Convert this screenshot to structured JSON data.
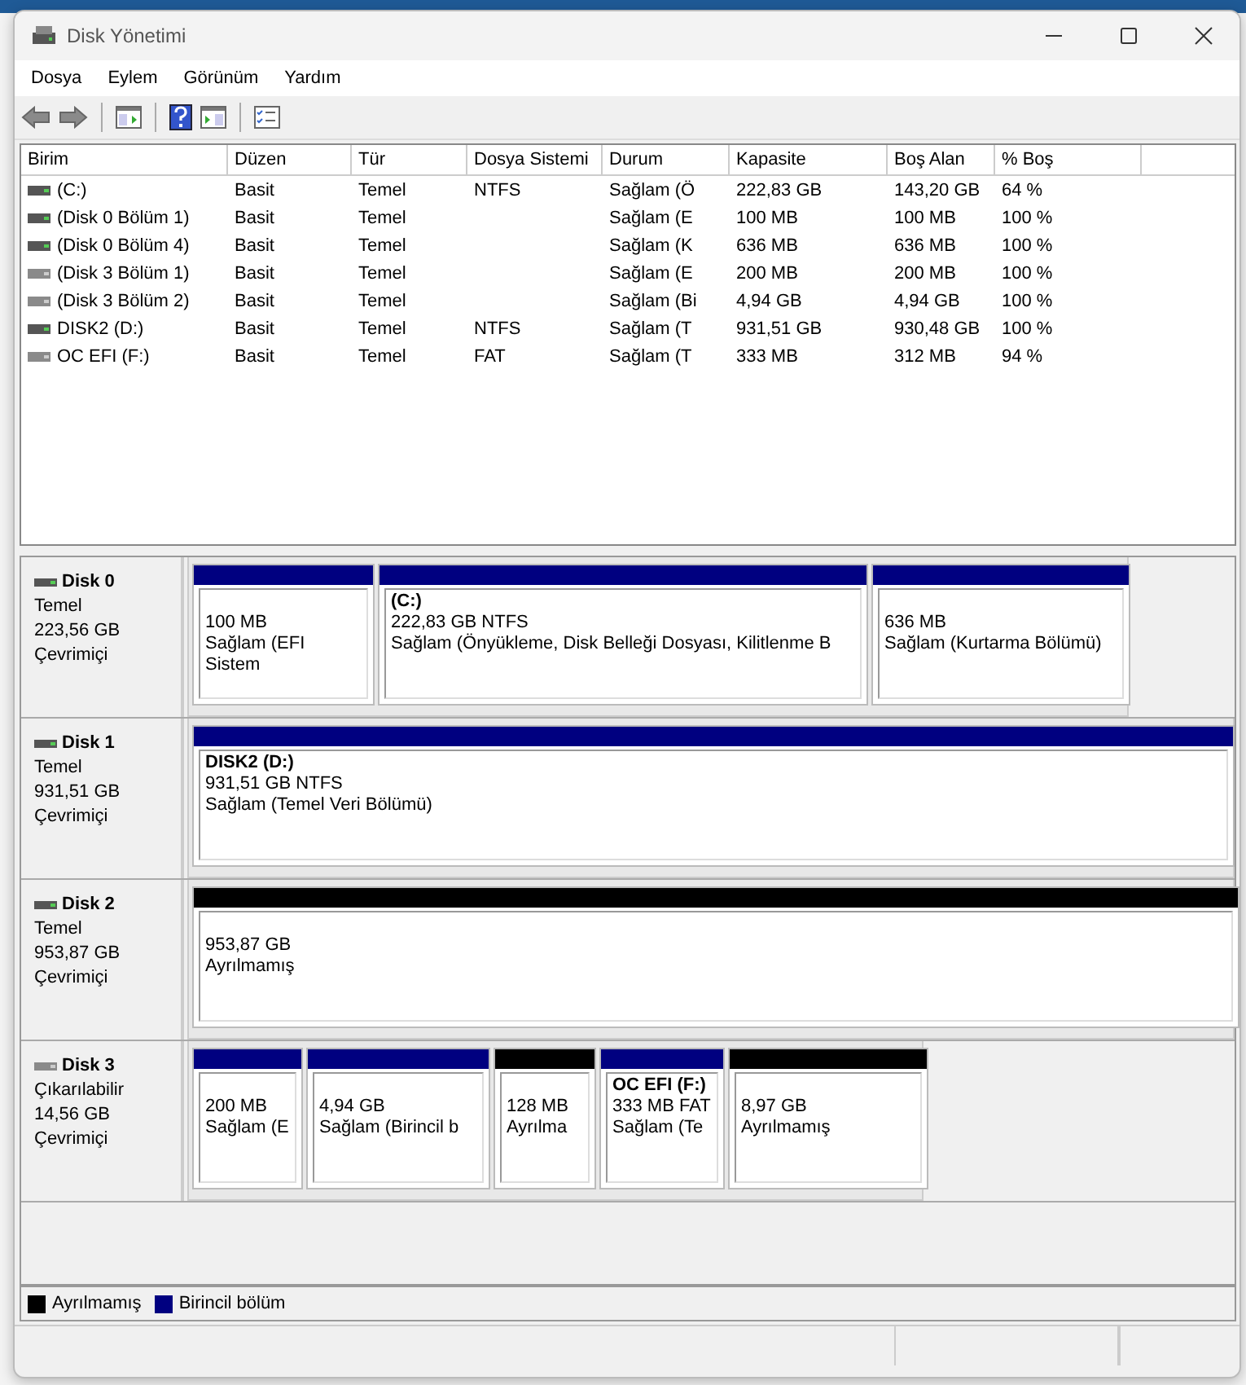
{
  "window": {
    "title": "Disk Yönetimi"
  },
  "menu": [
    "Dosya",
    "Eylem",
    "Görünüm",
    "Yardım"
  ],
  "volume_table": {
    "columns": [
      "Birim",
      "Düzen",
      "Tür",
      "Dosya Sistemi",
      "Durum",
      "Kapasite",
      "Boş Alan",
      "% Boş"
    ],
    "rows": [
      {
        "removable": false,
        "cells": [
          " (C:)",
          "Basit",
          "Temel",
          "NTFS",
          "Sağlam (Ö",
          "222,83 GB",
          "143,20 GB",
          "64 %"
        ]
      },
      {
        "removable": false,
        "cells": [
          "(Disk 0 Bölüm 1)",
          "Basit",
          "Temel",
          "",
          "Sağlam (E",
          "100 MB",
          "100 MB",
          "100 %"
        ]
      },
      {
        "removable": false,
        "cells": [
          "(Disk 0 Bölüm 4)",
          "Basit",
          "Temel",
          "",
          "Sağlam (K",
          "636 MB",
          "636 MB",
          "100 %"
        ]
      },
      {
        "removable": true,
        "cells": [
          "(Disk 3 Bölüm 1)",
          "Basit",
          "Temel",
          "",
          "Sağlam (E",
          "200 MB",
          "200 MB",
          "100 %"
        ]
      },
      {
        "removable": true,
        "cells": [
          "(Disk 3 Bölüm 2)",
          "Basit",
          "Temel",
          "",
          "Sağlam (Bi",
          "4,94 GB",
          "4,94 GB",
          "100 %"
        ]
      },
      {
        "removable": false,
        "cells": [
          "DISK2 (D:)",
          "Basit",
          "Temel",
          "NTFS",
          "Sağlam (T",
          "931,51 GB",
          "930,48 GB",
          "100 %"
        ]
      },
      {
        "removable": true,
        "cells": [
          "OC EFI (F:)",
          "Basit",
          "Temel",
          "FAT",
          "Sağlam (T",
          "333 MB",
          "312 MB",
          "94 %"
        ]
      }
    ]
  },
  "disks": [
    {
      "name": "Disk 0",
      "type": "Temel",
      "size": "223,56 GB",
      "status": "Çevrimiçi",
      "removable": false,
      "partitions": [
        {
          "kind": "primary",
          "lines": [
            "100 MB",
            "Sağlam (EFI Sistem"
          ]
        },
        {
          "kind": "primary",
          "label": " (C:)",
          "lines": [
            "222,83 GB NTFS",
            "Sağlam (Önyükleme, Disk Belleği Dosyası, Kilitlenme B"
          ]
        },
        {
          "kind": "primary",
          "lines": [
            "636 MB",
            "Sağlam (Kurtarma Bölümü)"
          ]
        }
      ]
    },
    {
      "name": "Disk 1",
      "type": "Temel",
      "size": "931,51 GB",
      "status": "Çevrimiçi",
      "removable": false,
      "partitions": [
        {
          "kind": "primary",
          "label": "DISK2  (D:)",
          "lines": [
            "931,51 GB NTFS",
            "Sağlam (Temel Veri Bölümü)"
          ]
        }
      ]
    },
    {
      "name": "Disk 2",
      "type": "Temel",
      "size": "953,87 GB",
      "status": "Çevrimiçi",
      "removable": false,
      "partitions": [
        {
          "kind": "unallocated",
          "lines": [
            "953,87 GB",
            "Ayrılmamış"
          ]
        }
      ]
    },
    {
      "name": "Disk 3",
      "type": "Çıkarılabilir",
      "size": "14,56 GB",
      "status": "Çevrimiçi",
      "removable": true,
      "partitions": [
        {
          "kind": "primary",
          "lines": [
            "200 MB",
            "Sağlam (E"
          ]
        },
        {
          "kind": "primary",
          "lines": [
            "4,94 GB",
            "Sağlam (Birincil b"
          ]
        },
        {
          "kind": "unallocated",
          "lines": [
            "128 MB",
            "Ayrılma"
          ]
        },
        {
          "kind": "primary",
          "label": "OC EFI  (F:)",
          "lines": [
            "333 MB FAT",
            "Sağlam (Te"
          ]
        },
        {
          "kind": "unallocated",
          "lines": [
            "8,97 GB",
            "Ayrılmamış"
          ]
        }
      ]
    }
  ],
  "legend": [
    {
      "kind": "unallocated",
      "label": "Ayrılmamış"
    },
    {
      "kind": "primary",
      "label": "Birincil bölüm"
    }
  ]
}
